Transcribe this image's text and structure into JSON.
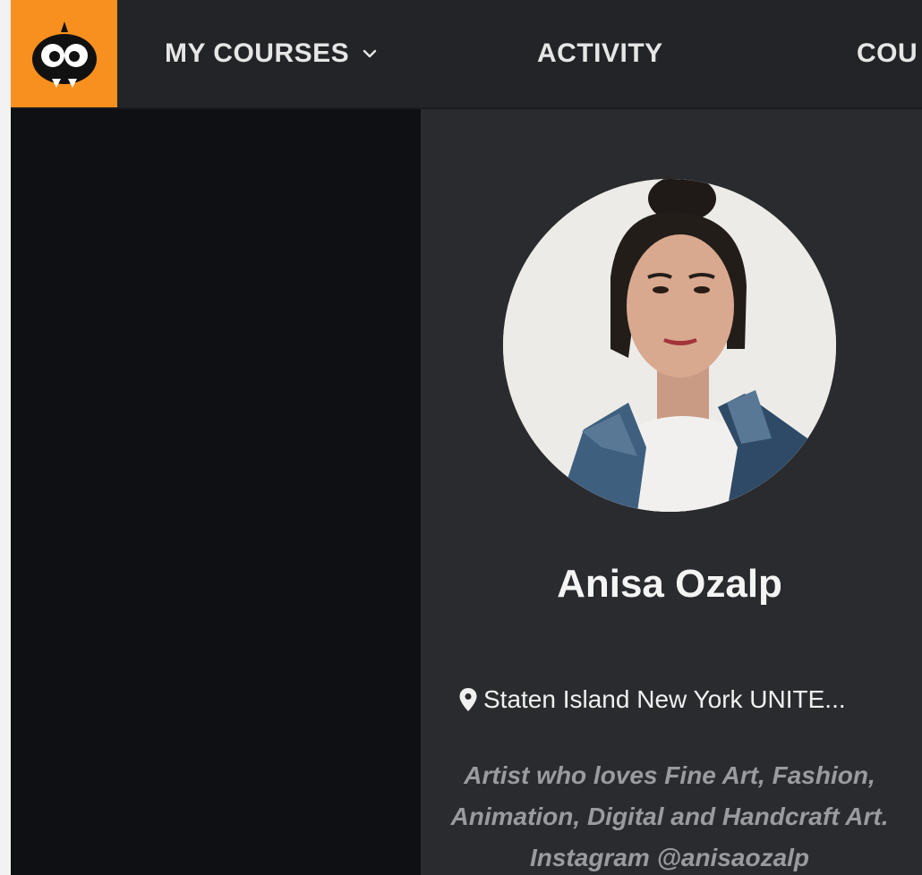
{
  "nav": {
    "items": [
      {
        "label": "MY COURSES",
        "has_dropdown": true
      },
      {
        "label": "ACTIVITY",
        "has_dropdown": false
      },
      {
        "label": "COU",
        "has_dropdown": false
      }
    ],
    "logo_icon": "owl-logo-icon",
    "logo_color": "#f7901e"
  },
  "profile": {
    "name": "Anisa Ozalp",
    "location": "Staten Island New York UNITE...",
    "location_icon": "map-pin-icon",
    "bio": "Artist who loves Fine Art, Fashion, Animation, Digital and Handcraft Art. Instagram @anisaozalp"
  }
}
